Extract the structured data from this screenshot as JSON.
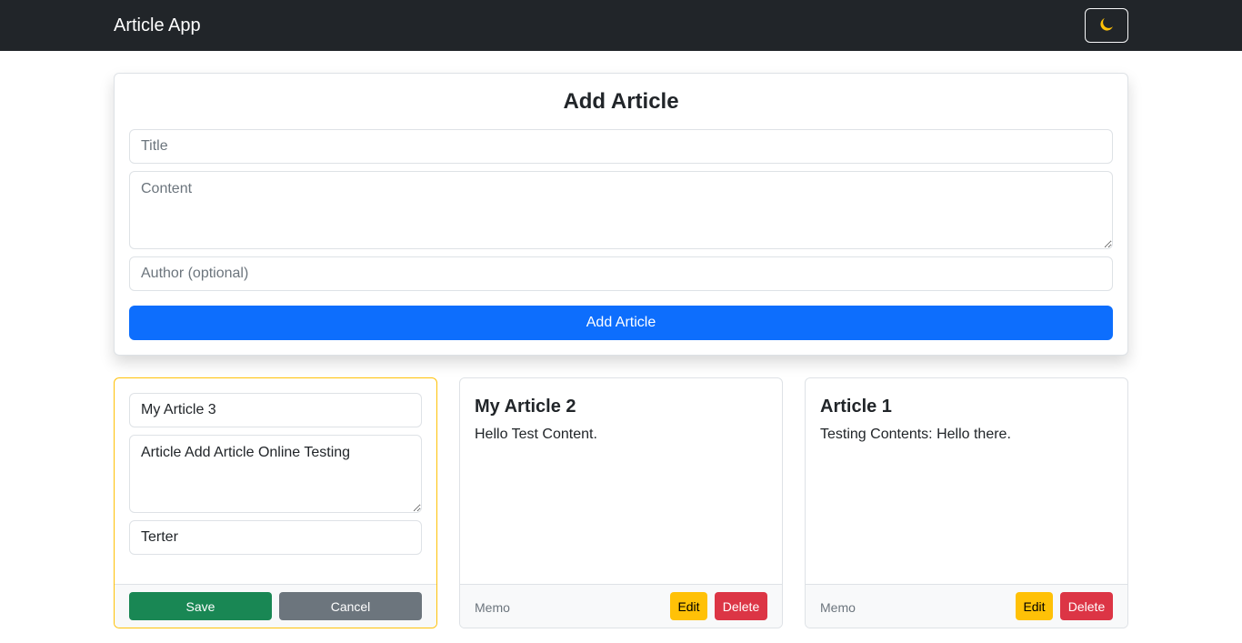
{
  "navbar": {
    "brand": "Article App",
    "theme_toggle_icon": "moon-icon"
  },
  "add_form": {
    "heading": "Add Article",
    "title_placeholder": "Title",
    "content_placeholder": "Content",
    "author_placeholder": "Author (optional)",
    "submit_label": "Add Article"
  },
  "editing_card": {
    "title_value": "My Article 3",
    "content_value": "Article Add Article Online Testing",
    "author_value": "Terter",
    "save_label": "Save",
    "cancel_label": "Cancel"
  },
  "articles": [
    {
      "title": "My Article 2",
      "content": "Hello Test Content.",
      "author": "Memo",
      "edit_label": "Edit",
      "delete_label": "Delete"
    },
    {
      "title": "Article 1",
      "content": "Testing Contents: Hello there.",
      "author": "Memo",
      "edit_label": "Edit",
      "delete_label": "Delete"
    }
  ],
  "colors": {
    "navbar": "#212529",
    "primary": "#0d6efd",
    "success": "#198754",
    "warning": "#ffc107",
    "danger": "#dc3545",
    "secondary": "#6c757d"
  }
}
